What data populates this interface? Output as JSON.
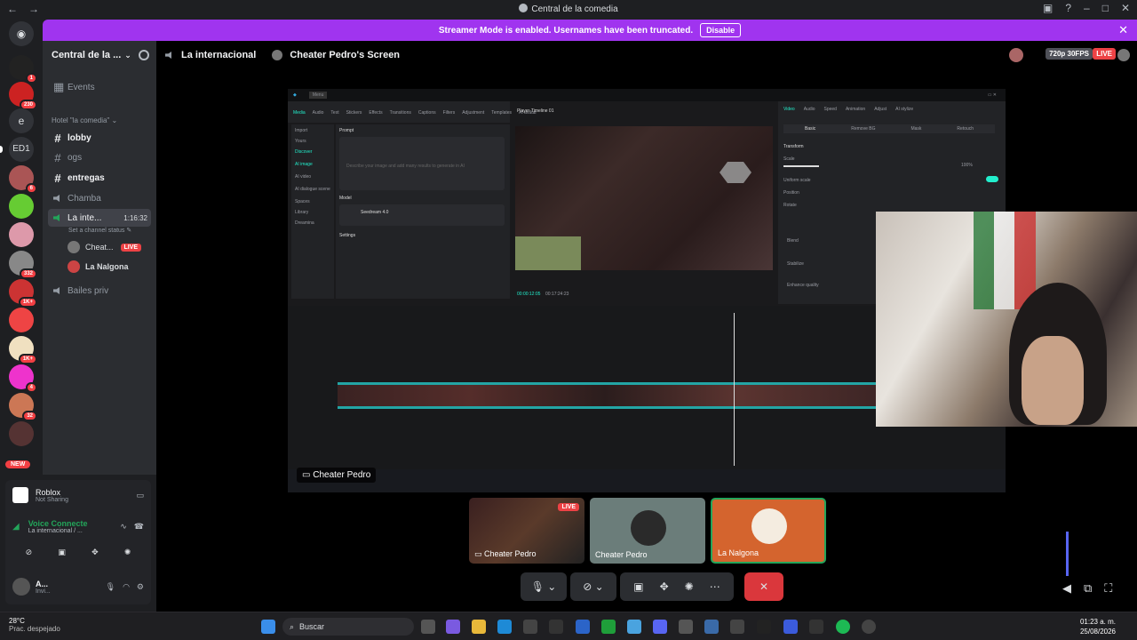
{
  "titlebar": {
    "title": "Central de la comedia"
  },
  "banner": {
    "text": "Streamer Mode is enabled. Usernames have been truncated.",
    "button": "Disable"
  },
  "servers": {
    "badges": [
      "1",
      "230",
      "e",
      "ED1",
      "6",
      "332",
      "1K+",
      "1K+",
      "4",
      "32"
    ],
    "new_label": "NEW"
  },
  "guild": {
    "name": "Central de la ...",
    "events": "Events",
    "category": "Hotel \"la comedia\"",
    "channels": [
      "lobby",
      "ogs",
      "entregas",
      "Chamba",
      "La inte...",
      "Bailes priv"
    ],
    "active_time": "1:16:32",
    "status_hint": "Set a channel status",
    "members": [
      {
        "name": "Cheat...",
        "live": "LIVE"
      },
      {
        "name": "La Nalgona"
      }
    ]
  },
  "userpanel": {
    "activity_title": "Roblox",
    "activity_sub": "Not Sharing",
    "voice_title": "Voice Connecte",
    "voice_sub": "La internacional / ...",
    "user_name": "A...",
    "user_sub": "Invi..."
  },
  "stage": {
    "channel": "La internacional",
    "stream_title": "Cheater Pedro's Screen",
    "quality": "720p 30FPS",
    "live": "LIVE",
    "screen_label": "Cheater Pedro"
  },
  "capcut": {
    "menu": [
      "Media",
      "Audio",
      "Text",
      "Stickers",
      "Effects",
      "Transitions",
      "Captions",
      "Filters",
      "Adjustment",
      "Templates",
      "AI avatar"
    ],
    "left_items": [
      "Import",
      "Yours",
      "Discover",
      "AI image",
      "AI video",
      "AI dialogue scene",
      "Spaces",
      "Library",
      "Dreamina"
    ],
    "prompt_label": "Prompt",
    "prompt_placeholder": "Describe your image and add many results to generate in AI",
    "model_label": "Model",
    "model_name": "Seedream 4.0",
    "settings_label": "Settings",
    "player_title": "Player-Timeline 01",
    "right_tabs": [
      "Video",
      "Audio",
      "Speed",
      "Animation",
      "Adjust",
      "AI stylize"
    ],
    "right_sub": [
      "Basic",
      "Remove BG",
      "Mask",
      "Retouch"
    ],
    "props": [
      "Transform",
      "Scale",
      "Uniform scale",
      "Position",
      "Rotate",
      "Blend",
      "Stabilize",
      "Enhance quality"
    ],
    "scale_value": "100%",
    "time_current": "00:00:12:05",
    "time_total": "00:17:24:23"
  },
  "tiles": [
    {
      "label": "Cheater Pedro",
      "live": "LIVE"
    },
    {
      "label": "Cheater Pedro"
    },
    {
      "label": "La Nalgona"
    }
  ],
  "taskbar": {
    "temp": "28°C",
    "weather": "Prac. despejado",
    "search": "Buscar",
    "time": "01:23 a. m.",
    "date": "25/08/2026"
  }
}
